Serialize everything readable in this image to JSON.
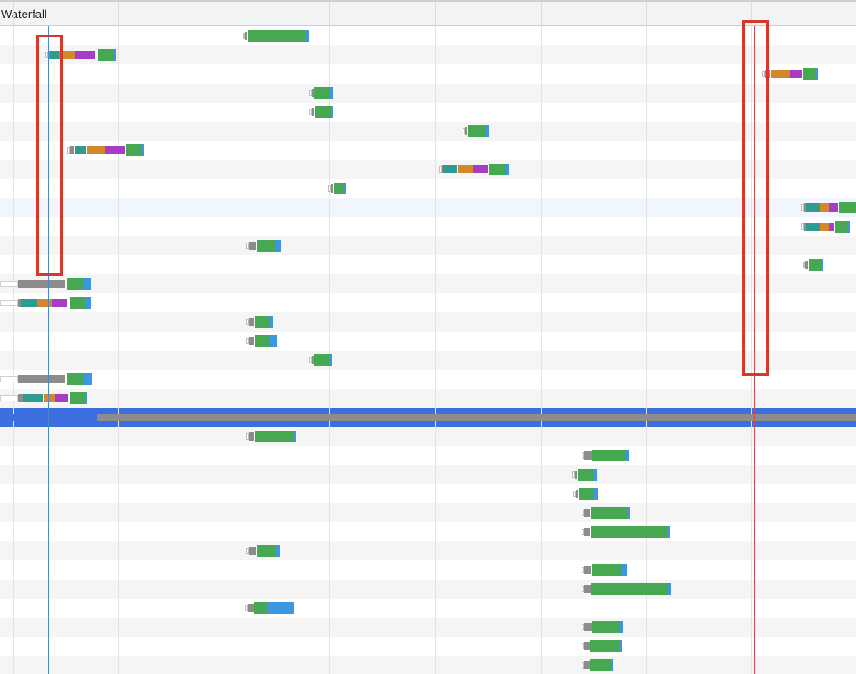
{
  "header": {
    "title": "Waterfall"
  },
  "colors": {
    "queue": "#ffffff",
    "stalled": "#8c8c8c",
    "dns": "#2f9a90",
    "connect": "#d3872c",
    "ssl": "#a73cc7",
    "waiting": "#46a951",
    "download": "#3d97e0",
    "dom_content_loaded_line": "#4a88c7",
    "load_line": "#cf4d4d",
    "selected_row": "#3b6fe0",
    "annotation": "#d6392a"
  },
  "legend_icons": [
    "queue-segment",
    "stalled-segment",
    "dns-segment",
    "connect-segment",
    "ssl-segment",
    "waiting-segment",
    "download-segment"
  ]
}
